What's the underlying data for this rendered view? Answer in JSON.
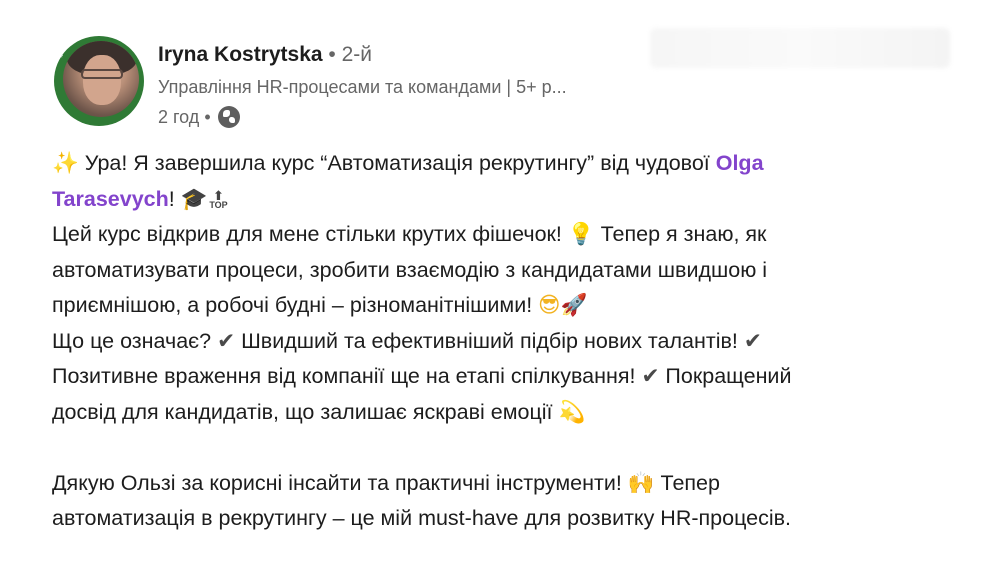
{
  "author": {
    "name": "Iryna Kostrytska",
    "separator": "•",
    "degree": "2-й",
    "headline": "Управління HR-процесами та командами | 5+ р...",
    "time": "2 год",
    "meta_separator": "•",
    "visibility_icon": "globe-icon",
    "avatar_badge": "#OPENTOWORK"
  },
  "post": {
    "line1": {
      "emoji": "✨",
      "text_before": " Ура! Я завершила курс “Автоматизація рекрутингу” від чудової ",
      "mention_part1": "Olga"
    },
    "line2": {
      "mention_part2": "Tarasevych",
      "text_after": "! ",
      "emoji_cap": "🎓",
      "top_label": "TOP",
      "top_arrow": "⬆"
    },
    "line3": {
      "text_before": "Цей курс відкрив для мене стільки крутих фішечок! ",
      "emoji_bulb": "💡",
      "text_after": " Тепер я знаю, як"
    },
    "line4": {
      "text": "автоматизувати процеси, зробити взаємодію з кандидатами швидшою і"
    },
    "line5": {
      "text": "приємнішою, а робочі будні – різноманітнішими! ",
      "emoji_face": "😎",
      "emoji_rocket": "🚀"
    },
    "line6": {
      "text_before": "Що це означає? ",
      "check1": "✔",
      "text_middle": " Швидший та ефективніший підбір нових талантів! ",
      "check2": "✔"
    },
    "line7": {
      "text_before": "Позитивне враження від компанії ще на етапі спілкування! ",
      "check3": "✔",
      "text_after": " Покращений"
    },
    "line8": {
      "text": "досвід для кандидатів, що залишає яскраві емоції ",
      "emoji_dizzy": "💫"
    },
    "line9": {
      "text_before": "Дякую Ользі за корисні інсайти та практичні інструменти! ",
      "emoji_hands": "🙌",
      "text_after": " Тепер"
    },
    "line10": {
      "text": "автоматизація в рекрутингу – це мій must-have для розвитку HR-процесів."
    }
  }
}
